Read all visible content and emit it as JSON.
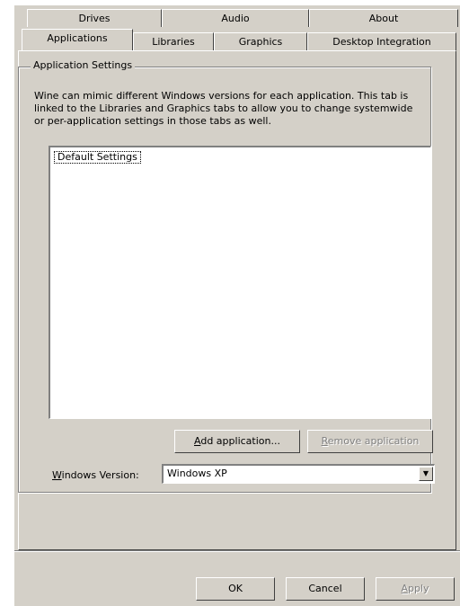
{
  "tabs_row1": [
    "Drives",
    "Audio",
    "About"
  ],
  "tabs_row2": [
    "Applications",
    "Libraries",
    "Graphics",
    "Desktop Integration"
  ],
  "group": {
    "title": "Application Settings",
    "description": "Wine can mimic different Windows versions for each application.  This tab is linked to the Libraries and Graphics tabs to allow you to change systemwide or per-application settings in those tabs as well."
  },
  "list": {
    "items": [
      "Default Settings"
    ]
  },
  "buttons": {
    "add_mnemonic": "A",
    "add_rest": "dd application...",
    "remove_mnemonic": "R",
    "remove_rest": "emove application"
  },
  "version": {
    "label_mnemonic": "W",
    "label_rest": "indows Version:",
    "selected": "Windows XP"
  },
  "dialog_buttons": {
    "ok": "OK",
    "cancel": "Cancel",
    "apply_mnemonic": "A",
    "apply_rest": "pply"
  }
}
